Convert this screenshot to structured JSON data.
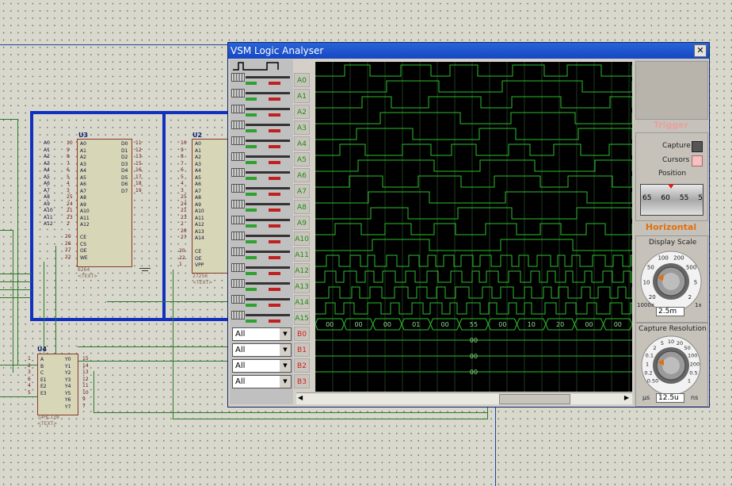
{
  "window": {
    "title": "VSM Logic Analyser",
    "close_label": "✕"
  },
  "channels": [
    "A0",
    "A1",
    "A2",
    "A3",
    "A4",
    "A5",
    "A6",
    "A7",
    "A8",
    "A9",
    "A10",
    "A11",
    "A12",
    "A13",
    "A14",
    "A15",
    "B0",
    "B1",
    "B2",
    "B3"
  ],
  "bus_selects": [
    "All",
    "All",
    "All",
    "All"
  ],
  "bus_values": {
    "B0": [
      "00",
      "00",
      "00",
      "01",
      "00",
      "55",
      "00",
      "10",
      "20",
      "00",
      "00"
    ],
    "B1": "00",
    "B2": "00",
    "B3": "00"
  },
  "trigger": {
    "title": "Trigger",
    "capture_label": "Capture",
    "cursors_label": "Cursors",
    "position_label": "Position",
    "position_ticks": [
      "65",
      "60",
      "55",
      "5"
    ]
  },
  "horizontal": {
    "title": "Horizontal",
    "display_scale": {
      "label": "Display Scale",
      "value": "2.5m",
      "min_label": "1000x",
      "max_label": "1x",
      "ticks": [
        "20",
        "10",
        "50",
        "100",
        "200",
        "500",
        "5",
        "2"
      ]
    },
    "capture_resolution": {
      "label": "Capture Resolution",
      "value": "12.5u",
      "unit_left": "µs",
      "unit_right": "ns",
      "ticks": [
        "0.50",
        "0.2",
        "1",
        "0.1",
        "2",
        "5",
        "10",
        "20",
        "50",
        "100",
        "200",
        "0.5",
        "1"
      ]
    }
  },
  "schematic": {
    "u3": {
      "ref": "U3",
      "part": "6264",
      "text": "<TEXT>",
      "left_pins": [
        "A0",
        "A1",
        "A2",
        "A3",
        "A4",
        "A5",
        "A6",
        "A7",
        "A8",
        "A9",
        "A10",
        "A11",
        "A12"
      ],
      "left_nums": [
        "10",
        "9",
        "8",
        "7",
        "6",
        "5",
        "4",
        "3",
        "25",
        "24",
        "21",
        "23",
        "2"
      ],
      "ctrl_pins": [
        "CE",
        "CS",
        "OE",
        "WE"
      ],
      "ctrl_nums": [
        "20",
        "26",
        "27",
        "22"
      ],
      "right_pins": [
        "D0",
        "D1",
        "D2",
        "D3",
        "D4",
        "D5",
        "D6",
        "D7"
      ],
      "right_nums": [
        "11",
        "12",
        "13",
        "15",
        "16",
        "17",
        "18",
        "19"
      ]
    },
    "u2": {
      "ref": "U2",
      "part": "27256",
      "text": "<TEXT>",
      "left_pins": [
        "A0",
        "A1",
        "A2",
        "A3",
        "A4",
        "A5",
        "A6",
        "A7",
        "A8",
        "A9",
        "A10",
        "A11",
        "A12",
        "A13",
        "A14"
      ],
      "left_nums": [
        "10",
        "9",
        "8",
        "7",
        "6",
        "5",
        "4",
        "3",
        "25",
        "24",
        "21",
        "23",
        "2",
        "26",
        "27"
      ],
      "ctrl_pins": [
        "CE",
        "OE",
        "VPP"
      ],
      "ctrl_nums": [
        "20",
        "22",
        "1"
      ]
    },
    "u4": {
      "ref": "U4",
      "part": "74HC138",
      "text": "<TEXT>",
      "left_pins": [
        "A",
        "B",
        "C",
        "E1",
        "E2",
        "E3"
      ],
      "left_nums": [
        "1",
        "2",
        "3",
        "6",
        "4",
        "5"
      ],
      "right_pins": [
        "Y0",
        "Y1",
        "Y2",
        "Y3",
        "Y4",
        "Y5",
        "Y6",
        "Y7"
      ],
      "right_nums": [
        "15",
        "14",
        "13",
        "12",
        "11",
        "10",
        "9",
        "7"
      ]
    }
  }
}
